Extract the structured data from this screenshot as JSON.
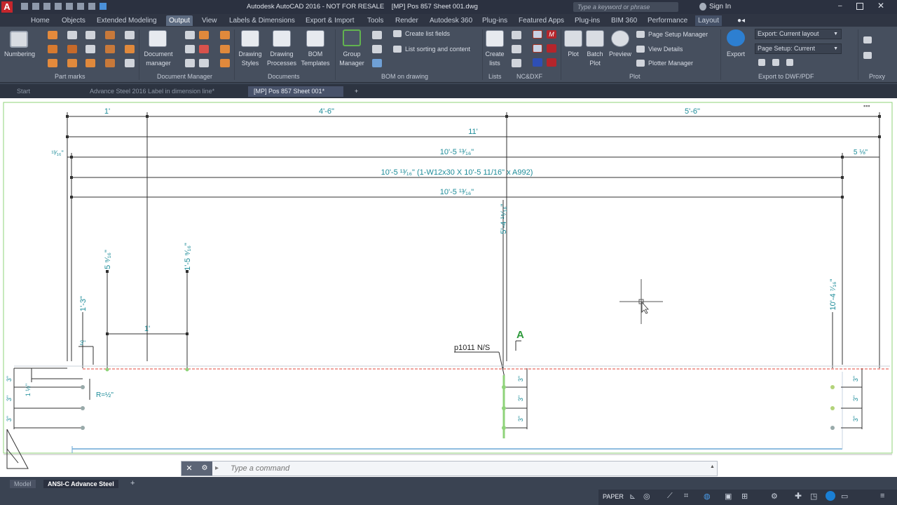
{
  "window": {
    "title": "Autodesk AutoCAD 2016 - NOT FOR RESALE    [MP] Pos 857 Sheet 001.dwg",
    "search_placeholder": "Type a keyword or phrase",
    "sign_in": "Sign In"
  },
  "ribbon_tabs": [
    "Home",
    "Objects",
    "Extended Modeling",
    "Output",
    "View",
    "Labels & Dimensions",
    "Export & Import",
    "Tools",
    "Render",
    "Autodesk 360",
    "Plug-ins",
    "Featured Apps",
    "Plug-ins",
    "BIM 360",
    "Performance",
    "Layout"
  ],
  "ribbon": {
    "numbering": "Numbering",
    "document_manager": [
      "Document",
      "manager"
    ],
    "drawing_styles": [
      "Drawing",
      "Styles"
    ],
    "drawing_processes": [
      "Drawing",
      "Processes"
    ],
    "bom_templates": [
      "BOM",
      "Templates"
    ],
    "group_manager": [
      "Group",
      "Manager"
    ],
    "create_list_fields": "Create list fields",
    "list_sorting": "List sorting and content",
    "create_lists": [
      "Create",
      "lists"
    ],
    "plot": "Plot",
    "batch_plot": [
      "Batch",
      "Plot"
    ],
    "preview": "Preview",
    "page_setup_manager": "Page Setup Manager",
    "view_details": "View Details",
    "plotter_manager": "Plotter Manager",
    "export": "Export",
    "export_current_layout": "Export: Current layout",
    "page_setup_current": "Page Setup: Current",
    "panels": [
      "Part marks",
      "Document Manager",
      "Documents",
      "BOM on drawing",
      "Lists",
      "NC&DXF",
      "Plot",
      "Export to DWF/PDF",
      "Proxy"
    ]
  },
  "doc_tabs": [
    "Start",
    "Advance Steel 2016 Label in dimension line*",
    "[MP] Pos 857 Sheet 001*"
  ],
  "drawing": {
    "dim_top": [
      "1'",
      "4'-6\"",
      "5'-6\""
    ],
    "dim_11": "11'",
    "dim_left_small": "¹³⁄₁₆\"",
    "dim_right_small": "5 ⅛\"",
    "dim_row3": "10'-5 ¹³⁄₁₆\"",
    "dim_row4": "10'-5 ¹³⁄₁₆\" (1-W12x30 X 10'-5 11/16\" x A992)",
    "dim_row5": "10'-5 ¹³⁄₁₆\"",
    "vdim_mid": "5'-4 ¹⁵⁄₁₆\"",
    "vdim_a": "5 ⁹⁄₁₆\"",
    "vdim_b": "1'-5 ⁹⁄₁₆\"",
    "vdim_c": "1'-3\"",
    "vdim_right": "10'-4 ⁷⁄₁₆\"",
    "dim_1_inner": "1'",
    "dim_3_small": "3\"",
    "vdim_1half": "1 ½\"",
    "radius": "R=½\"",
    "section_label": "A",
    "part_label": "p1011 N/S",
    "dim_3": "3\""
  },
  "command": {
    "placeholder": "Type a command"
  },
  "status": {
    "layout_tabs": [
      "Model",
      "ANSI-C Advance Steel"
    ],
    "paper": "PAPER"
  },
  "colors": {
    "dim": "#1d8c99",
    "line": "#303030",
    "red": "#e0483c",
    "accent": "#1a7fd4"
  }
}
